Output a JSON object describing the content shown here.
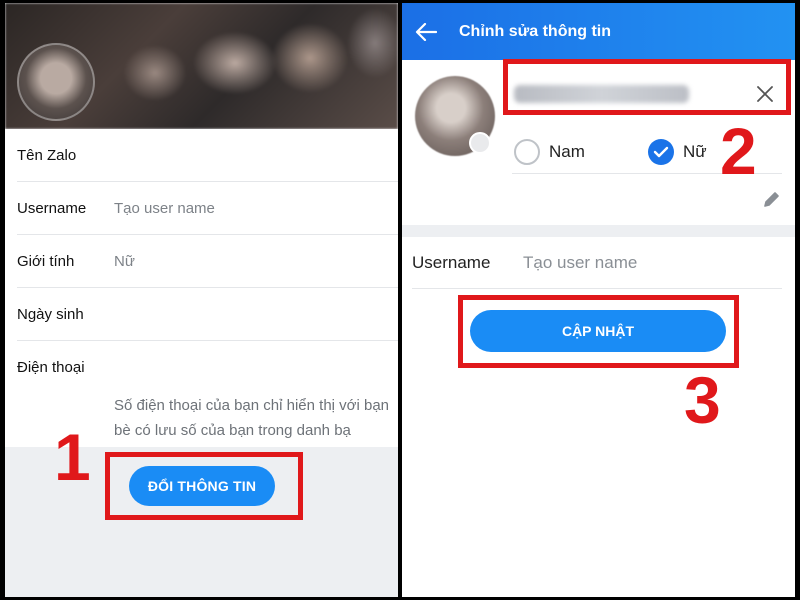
{
  "left": {
    "rows": [
      {
        "label": "Tên Zalo",
        "value": ""
      },
      {
        "label": "Username",
        "value": "Tạo user name"
      },
      {
        "label": "Giới tính",
        "value": "Nữ"
      },
      {
        "label": "Ngày sinh",
        "value": ""
      },
      {
        "label": "Điện thoại",
        "value": ""
      }
    ],
    "phone_note": "Số điện thoại của bạn chỉ hiển thị với bạn bè có lưu số của bạn trong danh bạ",
    "update_button_label": "ĐỔI THÔNG TIN",
    "step_number": "1"
  },
  "right": {
    "header_title": "Chỉnh sửa thông tin",
    "gender_options": [
      "Nam",
      "Nữ"
    ],
    "selected_gender": "Nữ",
    "username_label": "Username",
    "username_placeholder": "Tạo user name",
    "update_button_label": "CẬP NHẬT",
    "step_number_name": "2",
    "step_number_update": "3"
  },
  "colors": {
    "accent": "#1a8cf5",
    "header": "#1b6fe6",
    "highlight": "#e0181b"
  },
  "icons": [
    "back-arrow-icon",
    "clear-icon",
    "checkmark-icon",
    "pencil-icon",
    "camera-icon"
  ]
}
